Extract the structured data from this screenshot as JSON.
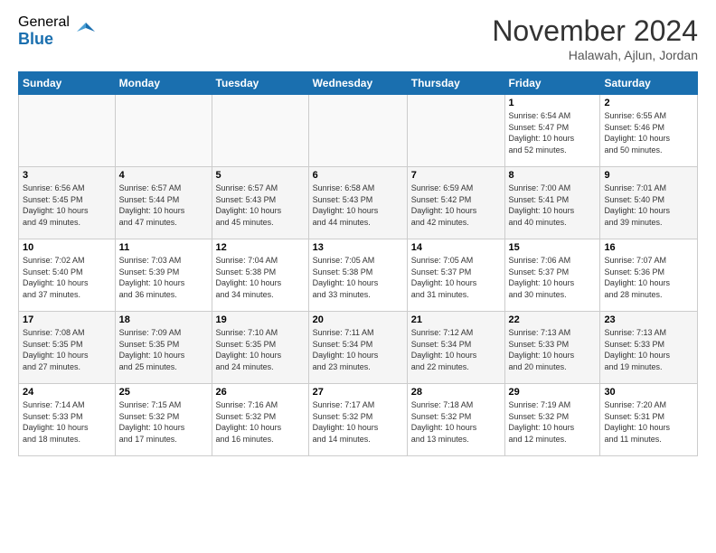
{
  "logo": {
    "general": "General",
    "blue": "Blue"
  },
  "header": {
    "month": "November 2024",
    "location": "Halawah, Ajlun, Jordan"
  },
  "weekdays": [
    "Sunday",
    "Monday",
    "Tuesday",
    "Wednesday",
    "Thursday",
    "Friday",
    "Saturday"
  ],
  "weeks": [
    [
      {
        "day": "",
        "info": ""
      },
      {
        "day": "",
        "info": ""
      },
      {
        "day": "",
        "info": ""
      },
      {
        "day": "",
        "info": ""
      },
      {
        "day": "",
        "info": ""
      },
      {
        "day": "1",
        "info": "Sunrise: 6:54 AM\nSunset: 5:47 PM\nDaylight: 10 hours\nand 52 minutes."
      },
      {
        "day": "2",
        "info": "Sunrise: 6:55 AM\nSunset: 5:46 PM\nDaylight: 10 hours\nand 50 minutes."
      }
    ],
    [
      {
        "day": "3",
        "info": "Sunrise: 6:56 AM\nSunset: 5:45 PM\nDaylight: 10 hours\nand 49 minutes."
      },
      {
        "day": "4",
        "info": "Sunrise: 6:57 AM\nSunset: 5:44 PM\nDaylight: 10 hours\nand 47 minutes."
      },
      {
        "day": "5",
        "info": "Sunrise: 6:57 AM\nSunset: 5:43 PM\nDaylight: 10 hours\nand 45 minutes."
      },
      {
        "day": "6",
        "info": "Sunrise: 6:58 AM\nSunset: 5:43 PM\nDaylight: 10 hours\nand 44 minutes."
      },
      {
        "day": "7",
        "info": "Sunrise: 6:59 AM\nSunset: 5:42 PM\nDaylight: 10 hours\nand 42 minutes."
      },
      {
        "day": "8",
        "info": "Sunrise: 7:00 AM\nSunset: 5:41 PM\nDaylight: 10 hours\nand 40 minutes."
      },
      {
        "day": "9",
        "info": "Sunrise: 7:01 AM\nSunset: 5:40 PM\nDaylight: 10 hours\nand 39 minutes."
      }
    ],
    [
      {
        "day": "10",
        "info": "Sunrise: 7:02 AM\nSunset: 5:40 PM\nDaylight: 10 hours\nand 37 minutes."
      },
      {
        "day": "11",
        "info": "Sunrise: 7:03 AM\nSunset: 5:39 PM\nDaylight: 10 hours\nand 36 minutes."
      },
      {
        "day": "12",
        "info": "Sunrise: 7:04 AM\nSunset: 5:38 PM\nDaylight: 10 hours\nand 34 minutes."
      },
      {
        "day": "13",
        "info": "Sunrise: 7:05 AM\nSunset: 5:38 PM\nDaylight: 10 hours\nand 33 minutes."
      },
      {
        "day": "14",
        "info": "Sunrise: 7:05 AM\nSunset: 5:37 PM\nDaylight: 10 hours\nand 31 minutes."
      },
      {
        "day": "15",
        "info": "Sunrise: 7:06 AM\nSunset: 5:37 PM\nDaylight: 10 hours\nand 30 minutes."
      },
      {
        "day": "16",
        "info": "Sunrise: 7:07 AM\nSunset: 5:36 PM\nDaylight: 10 hours\nand 28 minutes."
      }
    ],
    [
      {
        "day": "17",
        "info": "Sunrise: 7:08 AM\nSunset: 5:35 PM\nDaylight: 10 hours\nand 27 minutes."
      },
      {
        "day": "18",
        "info": "Sunrise: 7:09 AM\nSunset: 5:35 PM\nDaylight: 10 hours\nand 25 minutes."
      },
      {
        "day": "19",
        "info": "Sunrise: 7:10 AM\nSunset: 5:35 PM\nDaylight: 10 hours\nand 24 minutes."
      },
      {
        "day": "20",
        "info": "Sunrise: 7:11 AM\nSunset: 5:34 PM\nDaylight: 10 hours\nand 23 minutes."
      },
      {
        "day": "21",
        "info": "Sunrise: 7:12 AM\nSunset: 5:34 PM\nDaylight: 10 hours\nand 22 minutes."
      },
      {
        "day": "22",
        "info": "Sunrise: 7:13 AM\nSunset: 5:33 PM\nDaylight: 10 hours\nand 20 minutes."
      },
      {
        "day": "23",
        "info": "Sunrise: 7:13 AM\nSunset: 5:33 PM\nDaylight: 10 hours\nand 19 minutes."
      }
    ],
    [
      {
        "day": "24",
        "info": "Sunrise: 7:14 AM\nSunset: 5:33 PM\nDaylight: 10 hours\nand 18 minutes."
      },
      {
        "day": "25",
        "info": "Sunrise: 7:15 AM\nSunset: 5:32 PM\nDaylight: 10 hours\nand 17 minutes."
      },
      {
        "day": "26",
        "info": "Sunrise: 7:16 AM\nSunset: 5:32 PM\nDaylight: 10 hours\nand 16 minutes."
      },
      {
        "day": "27",
        "info": "Sunrise: 7:17 AM\nSunset: 5:32 PM\nDaylight: 10 hours\nand 14 minutes."
      },
      {
        "day": "28",
        "info": "Sunrise: 7:18 AM\nSunset: 5:32 PM\nDaylight: 10 hours\nand 13 minutes."
      },
      {
        "day": "29",
        "info": "Sunrise: 7:19 AM\nSunset: 5:32 PM\nDaylight: 10 hours\nand 12 minutes."
      },
      {
        "day": "30",
        "info": "Sunrise: 7:20 AM\nSunset: 5:31 PM\nDaylight: 10 hours\nand 11 minutes."
      }
    ]
  ]
}
